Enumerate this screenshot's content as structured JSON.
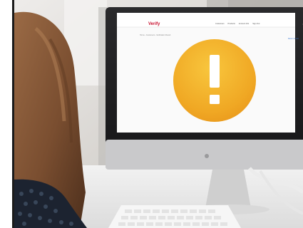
{
  "scene": {
    "description_tags": [
      "woman-at-desk",
      "desktop-monitor",
      "warning-alert"
    ],
    "colors": {
      "warning_gradient_top": "#f7c23a",
      "warning_gradient_bottom": "#ee9b1a",
      "brand_red": "#c8102e"
    }
  },
  "screen": {
    "brand": "Verify",
    "nav": [
      "Customers",
      "Products",
      "Account Info",
      "Sign Out"
    ],
    "breadcrumb": "Home › Customers › Verification Result",
    "right_link": "Return to List",
    "close_glyph": "×"
  },
  "icon": {
    "name": "warning-icon",
    "glyph": "!"
  }
}
